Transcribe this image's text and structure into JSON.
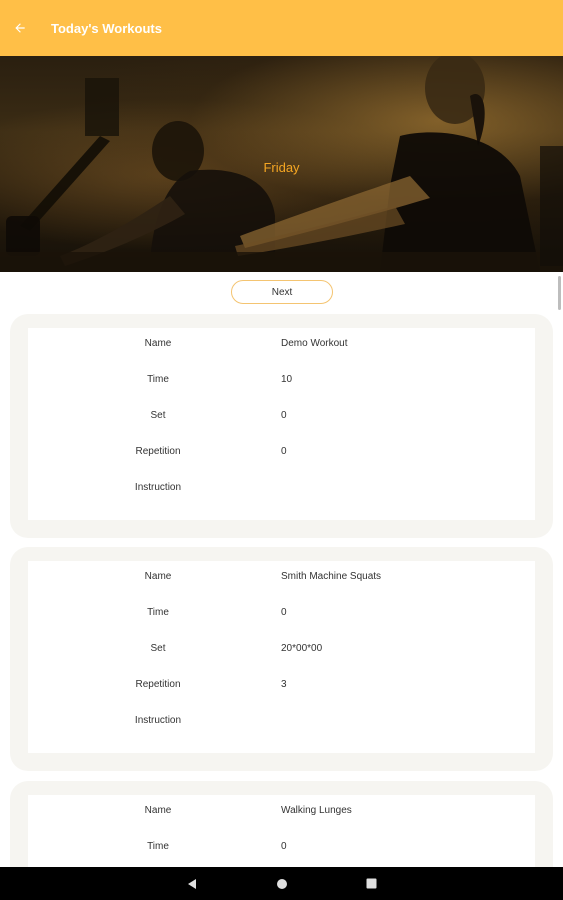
{
  "app_bar": {
    "title": "Today's Workouts",
    "back_icon": "arrow-back-icon",
    "color": "#ffbf47"
  },
  "hero": {
    "day": "Friday"
  },
  "next_button": {
    "label": "Next"
  },
  "workouts": [
    {
      "rows": [
        {
          "label": "Name",
          "value": "Demo Workout"
        },
        {
          "label": "Time",
          "value": "10"
        },
        {
          "label": "Set",
          "value": "0"
        },
        {
          "label": "Repetition",
          "value": "0"
        },
        {
          "label": "Instruction",
          "value": ""
        }
      ]
    },
    {
      "rows": [
        {
          "label": "Name",
          "value": "Smith Machine Squats"
        },
        {
          "label": "Time",
          "value": "0"
        },
        {
          "label": "Set",
          "value": "20*00*00"
        },
        {
          "label": "Repetition",
          "value": "3"
        },
        {
          "label": "Instruction",
          "value": ""
        }
      ]
    },
    {
      "rows": [
        {
          "label": "Name",
          "value": "Walking Lunges"
        },
        {
          "label": "Time",
          "value": "0"
        }
      ]
    }
  ],
  "nav_bar": {
    "back": "nav-back-icon",
    "home": "nav-home-icon",
    "recents": "nav-recents-icon"
  }
}
